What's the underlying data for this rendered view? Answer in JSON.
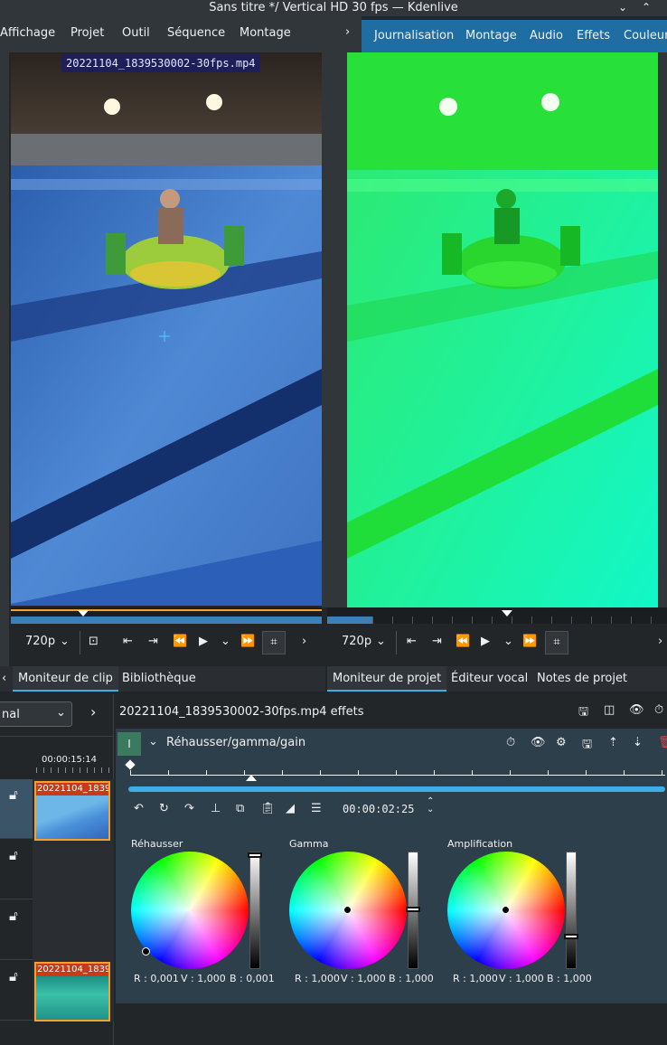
{
  "window": {
    "title": "Sans titre */ Vertical HD 30 fps — Kdenlive"
  },
  "menu": [
    "Affichage",
    "Projet",
    "Outil",
    "Séquence",
    "Montage"
  ],
  "layouts": [
    "Journalisation",
    "Montage",
    "Audio",
    "Effets",
    "Couleur"
  ],
  "clip_monitor": {
    "clip_name": "20221104_1839530002-30fps.mp4",
    "resolution": "720p"
  },
  "project_monitor": {
    "resolution": "720p"
  },
  "tabs_left": [
    "Moniteur de clip",
    "Bibliothèque"
  ],
  "tabs_right": [
    "Moniteur de projet",
    "Éditeur vocal",
    "Notes de projet"
  ],
  "timeline": {
    "mode_partial": "nal",
    "ruler_time": "00:00:15:14",
    "clips": [
      "20221104_1839",
      "20221104_1839"
    ]
  },
  "effects": {
    "title": "20221104_1839530002-30fps.mp4 effets",
    "effect_name": "Réhausser/gamma/gain",
    "effect_badge": "I",
    "timecode": "00:00:02:25",
    "wheels": [
      {
        "label": "Réhausser",
        "r": "R : 0,001",
        "v": "V : 1,000",
        "b": "B : 0,001",
        "slider": 1.0
      },
      {
        "label": "Gamma",
        "r": "R : 1,000",
        "v": "V : 1,000",
        "b": "B : 1,000",
        "slider": 0.5
      },
      {
        "label": "Amplification",
        "r": "R : 1,000",
        "v": "V : 1,000",
        "b": "B : 1,000",
        "slider": 0.25
      }
    ]
  }
}
